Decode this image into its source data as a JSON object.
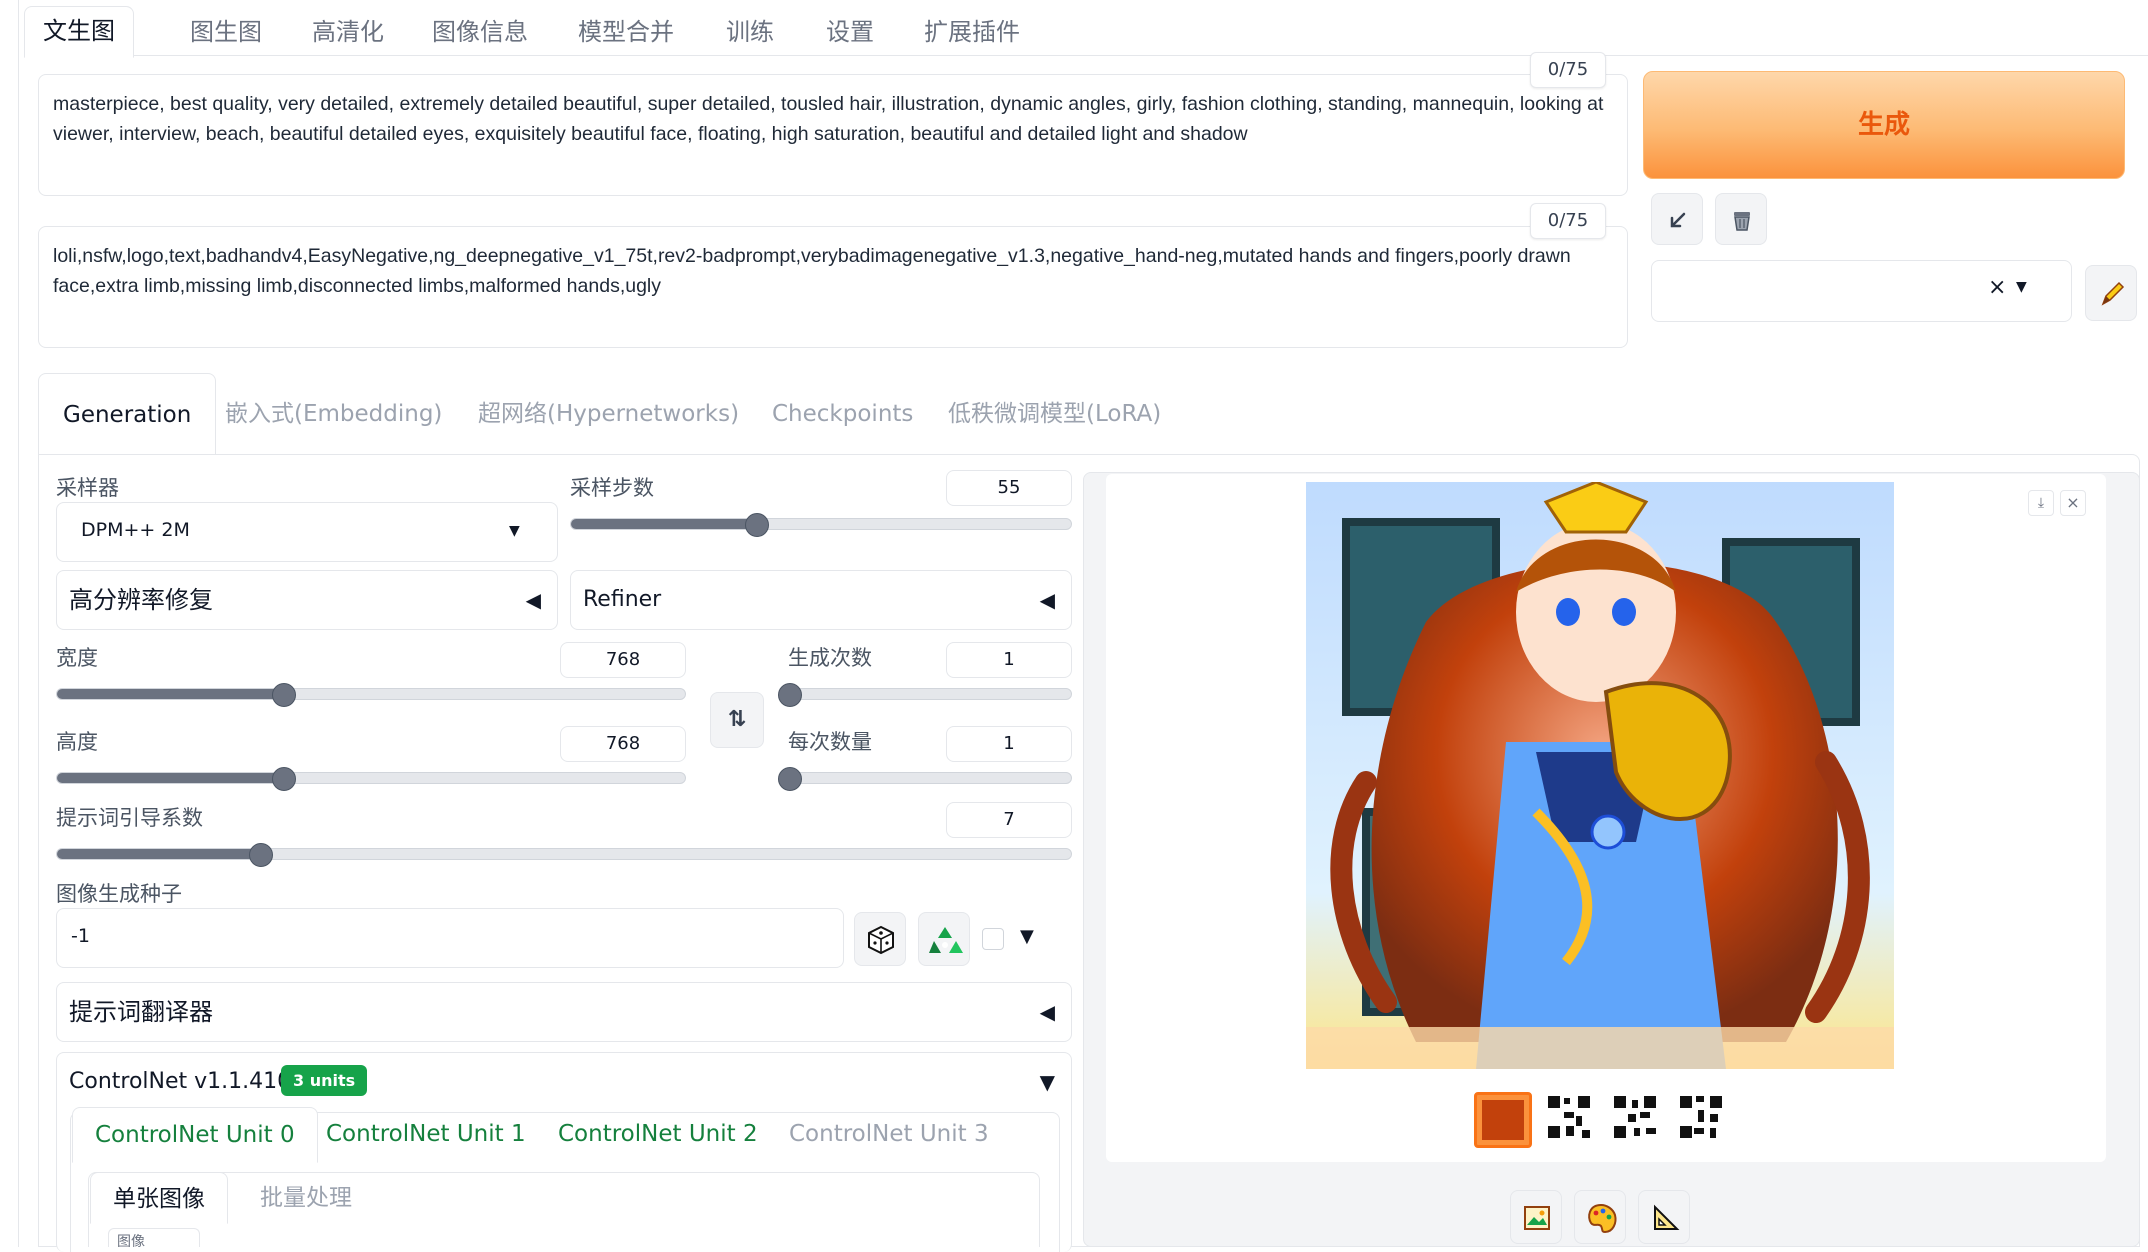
{
  "top_tabs": [
    "文生图",
    "图生图",
    "高清化",
    "图像信息",
    "模型合并",
    "训练",
    "设置",
    "扩展插件"
  ],
  "prompt": {
    "positive": "masterpiece, best quality, very detailed, extremely detailed beautiful, super detailed, tousled hair, illustration, dynamic angles, girly, fashion clothing, standing, mannequin, looking at viewer, interview, beach, beautiful detailed eyes, exquisitely beautiful face, floating, high saturation, beautiful and detailed light and shadow",
    "positive_counter": "0/75",
    "negative": "loli,nsfw,logo,text,badhandv4,EasyNegative,ng_deepnegative_v1_75t,rev2-badprompt,verybadimagenegative_v1.3,negative_hand-neg,mutated hands and fingers,poorly drawn face,extra limb,missing limb,disconnected limbs,malformed hands,ugly",
    "negative_counter": "0/75"
  },
  "actions": {
    "generate_label": "生成",
    "arrow_icon": "arrow-down-left-icon",
    "trash_icon": "trash-icon",
    "clear_x": "×",
    "pencil_icon": "pencil-icon"
  },
  "gen_tabs": [
    "Generation",
    "嵌入式(Embedding)",
    "超网络(Hypernetworks)",
    "Checkpoints",
    "低秩微调模型(LoRA)"
  ],
  "settings": {
    "sampler_label": "采样器",
    "sampler_value": "DPM++ 2M",
    "steps_label": "采样步数",
    "steps_value": "55",
    "steps_fraction": 0.37,
    "hires_label": "高分辨率修复",
    "refiner_label": "Refiner",
    "width_label": "宽度",
    "width_value": "768",
    "width_fraction": 0.36,
    "height_label": "高度",
    "height_value": "768",
    "height_fraction": 0.36,
    "batch_count_label": "生成次数",
    "batch_count_value": "1",
    "batch_size_label": "每次数量",
    "batch_size_value": "1",
    "cfg_label": "提示词引导系数",
    "cfg_value": "7",
    "cfg_fraction": 0.2,
    "seed_label": "图像生成种子",
    "seed_value": "-1",
    "translator_label": "提示词翻译器",
    "controlnet_label": "ControlNet v1.1.410",
    "controlnet_badge": "3 units",
    "unit_tabs": [
      "ControlNet Unit 0",
      "ControlNet Unit 1",
      "ControlNet Unit 2",
      "ControlNet Unit 3"
    ],
    "image_tabs": [
      "单张图像",
      "批量处理"
    ],
    "image_sub_label": "图像"
  },
  "output": {
    "download_icon": "download-icon",
    "close_icon": "close-icon",
    "bottom_icons": [
      "picture-icon",
      "palette-icon",
      "ruler-triangle-icon"
    ]
  },
  "colors": {
    "generate_bg": "#fdba74",
    "generate_text": "#ea580c",
    "accent_green": "#15803d",
    "badge_green": "#16a34a"
  }
}
